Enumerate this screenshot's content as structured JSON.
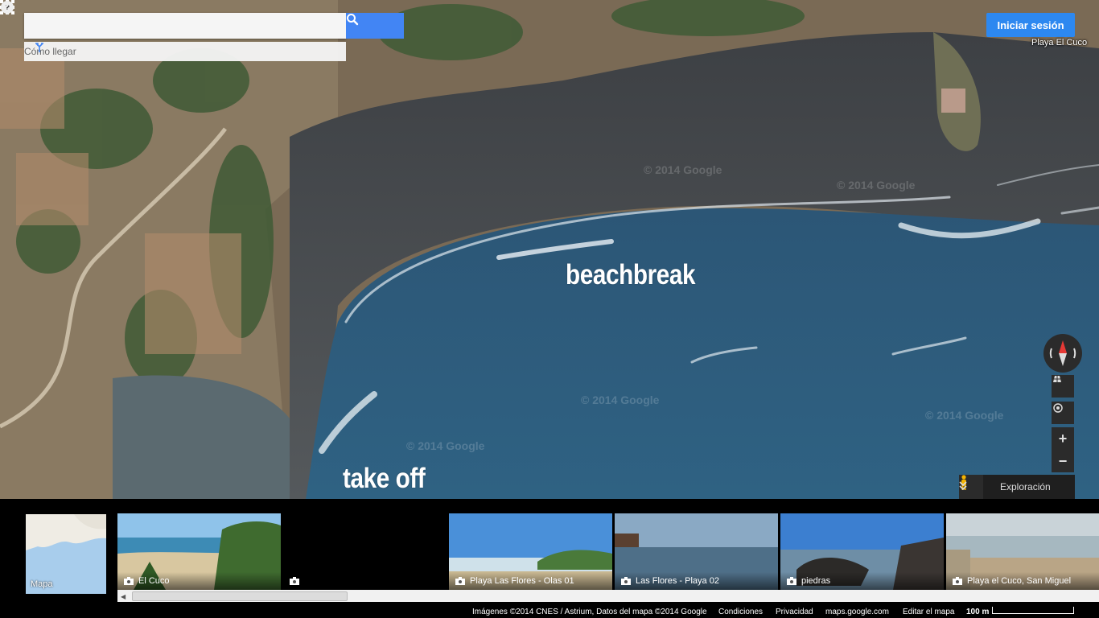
{
  "search": {
    "placeholder": "",
    "value": ""
  },
  "directions": {
    "label": "Cómo llegar"
  },
  "header": {
    "signin_label": "Iniciar sesión",
    "place_label": "Playa El Cuco"
  },
  "map_overlay": {
    "label_beachbreak": "beachbreak",
    "label_takeoff": "take off"
  },
  "watermarks": [
    "© 2014 Google",
    "© 2014 Google",
    "© 2014 Google",
    "© 2014 Google",
    "© 2014 Google"
  ],
  "controls": {
    "explore_label": "Exploración",
    "zoom_in": "+",
    "zoom_out": "−"
  },
  "filmstrip": {
    "map_label": "Mapa",
    "photos": [
      {
        "caption": "El Cuco"
      },
      {
        "caption": ""
      },
      {
        "caption": "Playa Las Flores - Olas 01"
      },
      {
        "caption": "Las Flores - Playa 02"
      },
      {
        "caption": "piedras"
      },
      {
        "caption": "Playa el Cuco, San Miguel"
      }
    ]
  },
  "footer": {
    "attribution": "Imágenes ©2014 CNES / Astrium, Datos del mapa ©2014 Google",
    "terms": "Condiciones",
    "privacy": "Privacidad",
    "site": "maps.google.com",
    "edit": "Editar el mapa",
    "scale": "100 m"
  },
  "colors": {
    "accent": "#4285f4",
    "signin": "#2d88f0",
    "sea": "#2f5c7e",
    "sand": "#4b4e52"
  }
}
